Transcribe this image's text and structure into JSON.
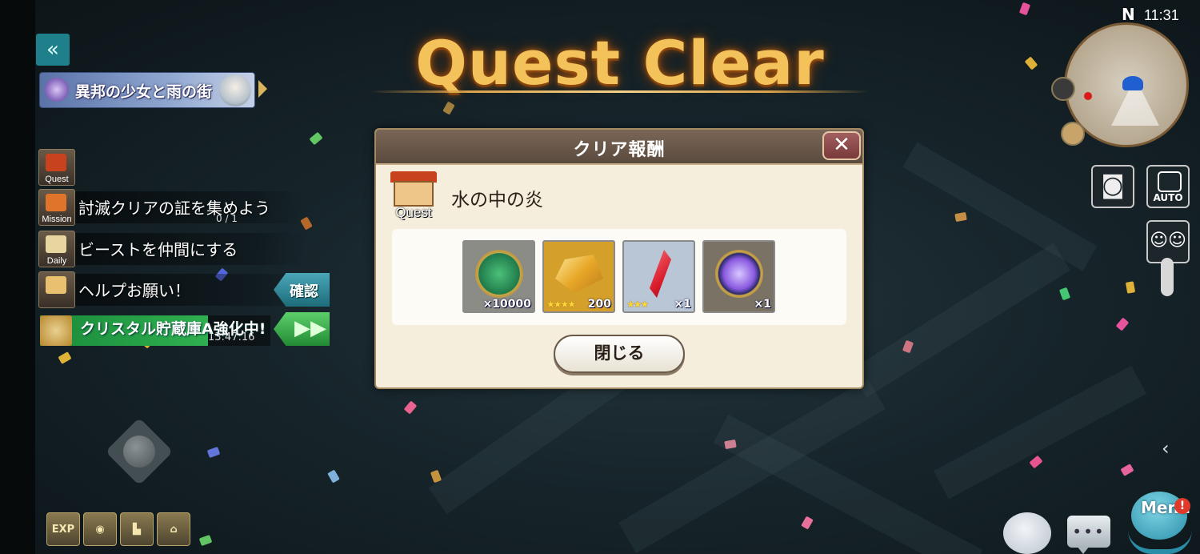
{
  "title": "Quest Clear",
  "clock": "11:31",
  "compass": "N",
  "area_banner": {
    "name": "異邦の少女と雨の街"
  },
  "hud": {
    "missions": [
      {
        "tag": "Quest",
        "text": "",
        "progress": ""
      },
      {
        "tag": "Mission",
        "text": "討滅クリアの証を集めよう",
        "progress": "0 / 1"
      },
      {
        "tag": "Daily",
        "text": "ビーストを仲間にする",
        "progress": ""
      },
      {
        "tag": "",
        "text": "ヘルプお願い！",
        "progress": ""
      }
    ],
    "confirm_label": "確認",
    "crystal": {
      "text": "クリスタル貯蔵庫A強化中!",
      "timer": "13:47:16"
    },
    "forward_label": "▶▶",
    "bottom_icons": [
      "EXP",
      "",
      "",
      ""
    ]
  },
  "dialog": {
    "title": "クリア報酬",
    "close_symbol": "✕",
    "quest_tag": "Quest",
    "quest_name": "水の中の炎",
    "rewards": [
      {
        "icon": "green-medal-icon",
        "stars": "",
        "quantity": "×10000",
        "bg": "#8c8c86"
      },
      {
        "icon": "gold-bars-icon",
        "stars": "★★★★",
        "quantity": "200",
        "bg": "#d4a02a"
      },
      {
        "icon": "red-crystal-icon",
        "stars": "★★★",
        "quantity": "×1",
        "bg": "#b8c6d6"
      },
      {
        "icon": "purple-gem-emblem-icon",
        "stars": "",
        "quantity": "×1",
        "bg": "#7a7264"
      }
    ],
    "close_button_label": "閉じる"
  },
  "right_hud": {
    "auto_label": "AUTO",
    "menu_label": "Menu",
    "menu_badge": "!",
    "chevron": "‹"
  },
  "colors": {
    "title_gold": "#f4c25a",
    "dialog_bg": "#f5eedc",
    "dialog_header": "#6a5a4c",
    "crystal_green": "#2fb050",
    "confirm_teal": "#2a8a9a"
  }
}
